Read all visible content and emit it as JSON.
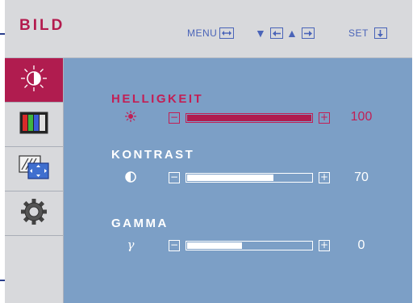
{
  "menu": {
    "title": "BILD",
    "hints": {
      "menu_label": "MENU",
      "down_arrow": "▼",
      "up_arrow": "▲",
      "set_label": "SET"
    }
  },
  "sidebar": {
    "items": [
      {
        "icon": "brightness-icon",
        "active": true
      },
      {
        "icon": "color-bars-icon",
        "active": false
      },
      {
        "icon": "screen-position-icon",
        "active": false
      },
      {
        "icon": "settings-gear-icon",
        "active": false
      }
    ]
  },
  "params": [
    {
      "name": "HELLIGKEIT",
      "symbol": "brightness",
      "value": "100",
      "level": 1.0,
      "selected": true
    },
    {
      "name": "KONTRAST",
      "symbol": "contrast",
      "value": "70",
      "level": 0.7,
      "selected": false
    },
    {
      "name": "GAMMA",
      "symbol": "γ",
      "value": "0",
      "level": 0.45,
      "selected": false
    }
  ],
  "colors": {
    "accent": "#b01c4f",
    "selected_text": "#c21f55",
    "content_bg": "#7c9fc6",
    "panel_bg": "#d8d9dc",
    "hint_blue": "#4a64b8"
  }
}
